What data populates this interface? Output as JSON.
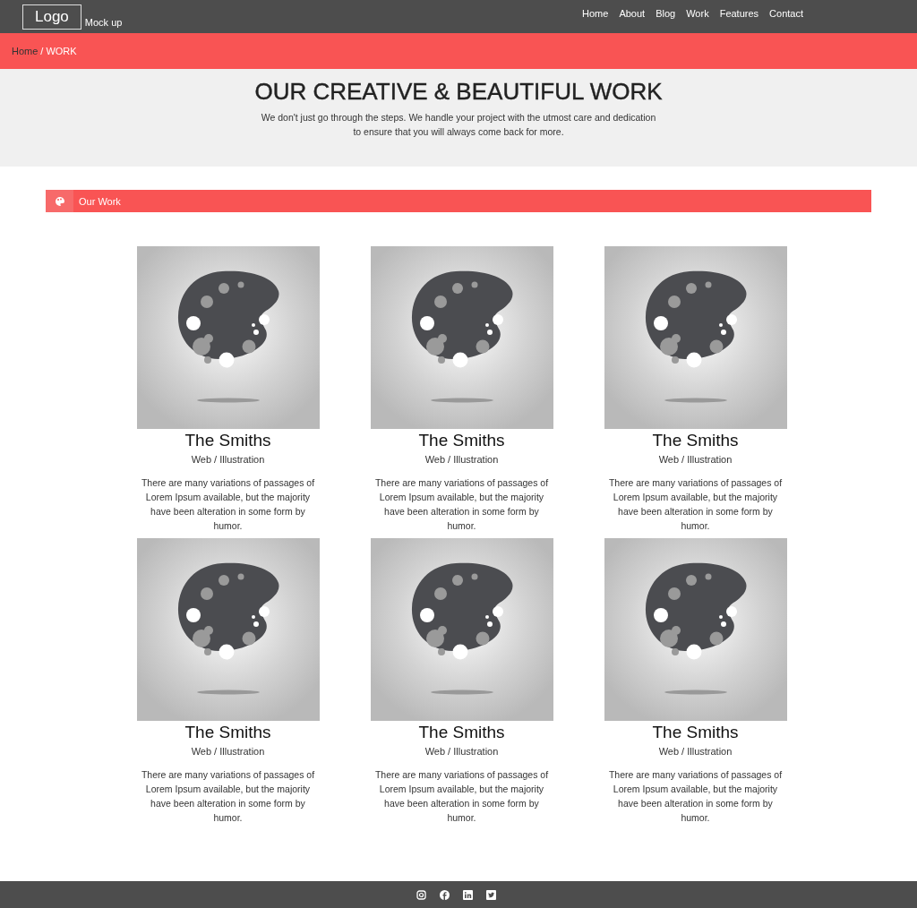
{
  "header": {
    "logo": "Logo",
    "tagline": "Mock up",
    "nav": [
      {
        "label": "Home"
      },
      {
        "label": "About"
      },
      {
        "label": "Blog"
      },
      {
        "label": "Work"
      },
      {
        "label": "Features"
      },
      {
        "label": "Contact"
      }
    ]
  },
  "breadcrumb": {
    "separator": "/",
    "items": [
      {
        "label": "Home",
        "current": false
      },
      {
        "label": "WORK",
        "current": true
      }
    ]
  },
  "hero": {
    "title": "OUR CREATIVE & BEAUTIFUL WORK",
    "lines": [
      "We don't just go through the steps. We handle your project with the utmost care and dedication",
      "to ensure that you will always come back for more."
    ]
  },
  "section": {
    "title": "Our Work"
  },
  "projects": [
    {
      "title": "The Smiths",
      "category": "Web / Illustration",
      "description": "There are many variations of passages of Lorem Ipsum available, but the majority have been alteration in some form by humor."
    },
    {
      "title": "The Smiths",
      "category": "Web / Illustration",
      "description": "There are many variations of passages of Lorem Ipsum available, but the majority have been alteration in some form by humor."
    },
    {
      "title": "The Smiths",
      "category": "Web / Illustration",
      "description": "There are many variations of passages of Lorem Ipsum available, but the majority have been alteration in some form by humor."
    },
    {
      "title": "The Smiths",
      "category": "Web / Illustration",
      "description": "There are many variations of passages of Lorem Ipsum available, but the majority have been alteration in some form by humor."
    },
    {
      "title": "The Smiths",
      "category": "Web / Illustration",
      "description": "There are many variations of passages of Lorem Ipsum available, but the majority have been alteration in some form by humor."
    },
    {
      "title": "The Smiths",
      "category": "Web / Illustration",
      "description": "There are many variations of passages of Lorem Ipsum available, but the majority have been alteration in some form by humor."
    }
  ],
  "footer": {
    "social": [
      {
        "kind": "camera"
      },
      {
        "kind": "f"
      },
      {
        "kind": "in"
      },
      {
        "kind": "bird"
      }
    ]
  }
}
